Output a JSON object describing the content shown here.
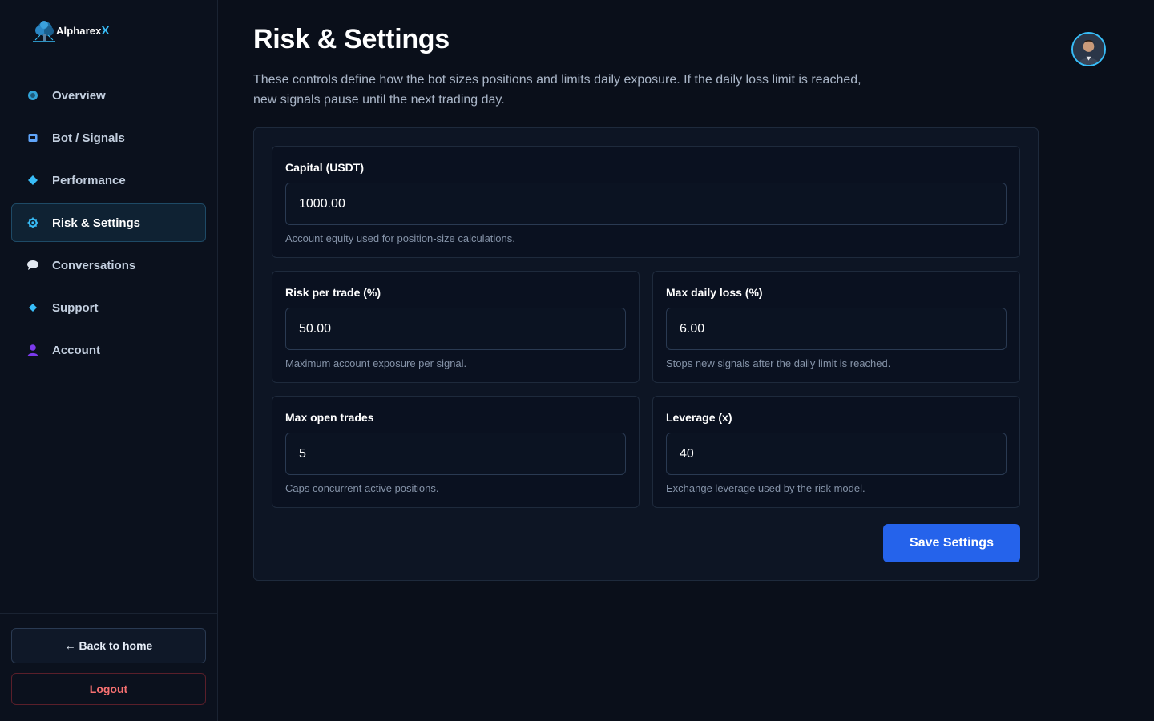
{
  "brand": {
    "name": "Alpharex",
    "mark": "X",
    "logo_icon": "tree-logo-icon"
  },
  "sidebar": {
    "items": [
      {
        "label": "Overview",
        "icon": "circle-icon",
        "color": "#38bdf8",
        "active": false
      },
      {
        "label": "Bot / Signals",
        "icon": "robot-icon",
        "color": "#60a5fa",
        "active": false
      },
      {
        "label": "Performance",
        "icon": "diamond-icon",
        "color": "#38bdf8",
        "active": false
      },
      {
        "label": "Risk & Settings",
        "icon": "gear-icon",
        "color": "#38bdf8",
        "active": true
      },
      {
        "label": "Conversations",
        "icon": "chat-bubble-icon",
        "color": "#e2e8f0",
        "active": false
      },
      {
        "label": "Support",
        "icon": "diamond-icon",
        "color": "#38bdf8",
        "active": false
      },
      {
        "label": "Account",
        "icon": "user-icon",
        "color": "#7c3aed",
        "active": false
      }
    ],
    "back_home": "← Back to home",
    "logout": "Logout"
  },
  "header": {
    "title": "Risk & Settings",
    "description": "These controls define how the bot sizes positions and limits daily exposure. If the daily loss limit is reached, new signals pause until the next trading day.",
    "avatar_icon": "user-avatar-icon"
  },
  "form": {
    "capital": {
      "label": "Capital (USDT)",
      "value": "1000.00",
      "help": "Account equity used for position-size calculations."
    },
    "risk_per_trade": {
      "label": "Risk per trade (%)",
      "value": "50.00",
      "help": "Maximum account exposure per signal."
    },
    "max_daily_loss": {
      "label": "Max daily loss (%)",
      "value": "6.00",
      "help": "Stops new signals after the daily limit is reached."
    },
    "max_open_trades": {
      "label": "Max open trades",
      "value": "5",
      "help": "Caps concurrent active positions."
    },
    "leverage": {
      "label": "Leverage (x)",
      "value": "40",
      "help": "Exchange leverage used by the risk model."
    },
    "save_label": "Save Settings"
  },
  "colors": {
    "accent": "#2563eb",
    "active_border": "#1e4a66",
    "danger": "#f87171",
    "avatar_ring": "#38bdf8"
  }
}
